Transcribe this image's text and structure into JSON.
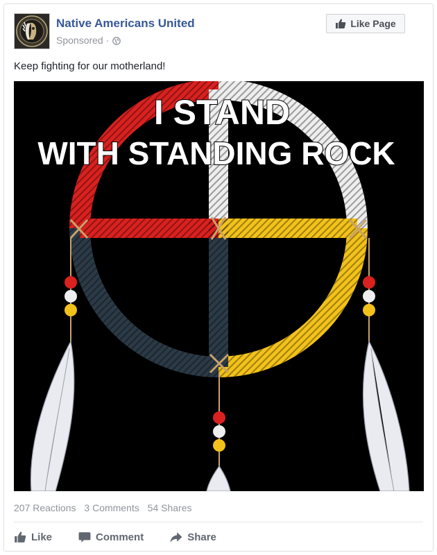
{
  "post": {
    "page_name": "Native Americans United",
    "sponsored_label": "Sponsored",
    "separator": "·",
    "like_page_label": "Like Page",
    "message": "Keep fighting for our motherland!",
    "image": {
      "headline_line1": "I STAND",
      "headline_line2": "WITH STANDING ROCK",
      "colors": {
        "red": "#d9211f",
        "white": "#eeeeee",
        "yellow": "#f3c21a",
        "dark": "#2b3a46",
        "background": "#000000"
      }
    },
    "stats": {
      "reactions": "207 Reactions",
      "comments": "3 Comments",
      "shares": "54 Shares"
    },
    "actions": {
      "like": "Like",
      "comment": "Comment",
      "share": "Share"
    },
    "icons": {
      "like": "thumbs-up-icon",
      "comment": "comment-bubble-icon",
      "share": "share-arrow-icon",
      "audience": "globe-icon"
    }
  }
}
